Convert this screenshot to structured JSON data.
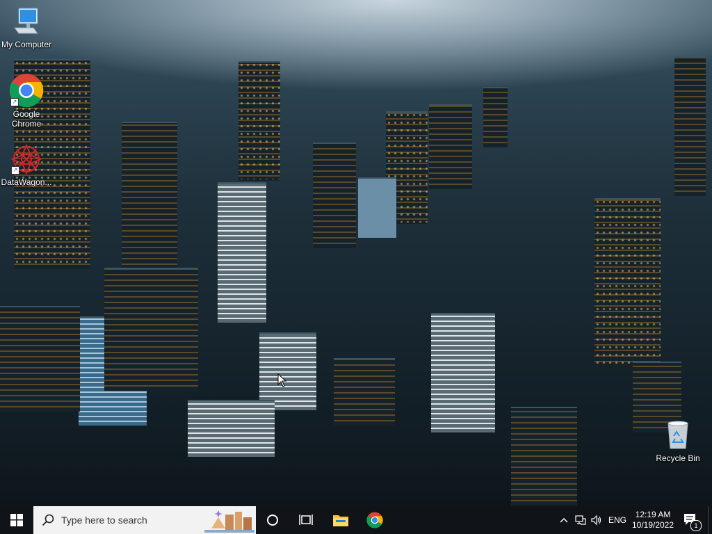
{
  "desktop": {
    "icons": [
      {
        "label": "My Computer",
        "icon": "computer-icon"
      },
      {
        "label": "Google Chrome",
        "line1": "Google",
        "line2": "Chrome",
        "icon": "chrome-icon"
      },
      {
        "label": "DataWagon...",
        "icon": "datawagon-icon"
      },
      {
        "label": "Recycle Bin",
        "icon": "recycle-bin-icon"
      }
    ]
  },
  "taskbar": {
    "start_icon": "windows-logo-icon",
    "search_placeholder": "Type here to search",
    "pinned": [
      "cortana-icon",
      "task-view-icon",
      "file-explorer-icon",
      "chrome-icon"
    ],
    "tray": {
      "language": "ENG",
      "time": "12:19 AM",
      "date": "10/19/2022",
      "notifications_count": "1"
    }
  },
  "colors": {
    "taskbar_bg": "#101418",
    "search_bg": "#f2f2f2",
    "accent": "#0078d7"
  }
}
